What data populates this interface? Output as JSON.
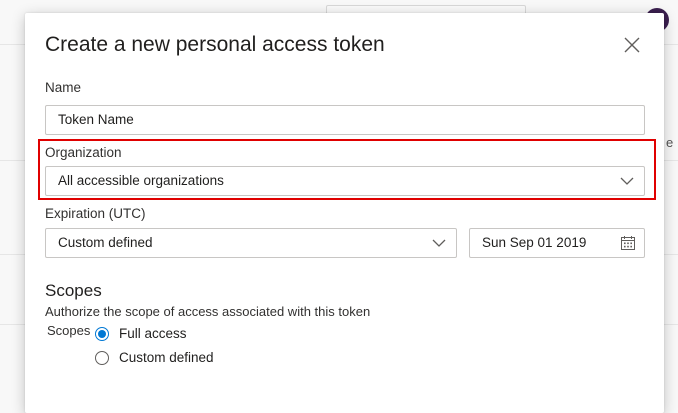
{
  "dialog": {
    "title": "Create a new personal access token",
    "close_icon": "close-icon"
  },
  "name": {
    "label": "Name",
    "value": "Token Name"
  },
  "organization": {
    "label": "Organization",
    "selected": "All accessible organizations"
  },
  "expiration": {
    "label": "Expiration (UTC)",
    "selected": "Custom defined",
    "date": "Sun Sep 01 2019"
  },
  "scopes": {
    "heading": "Scopes",
    "description": "Authorize the scope of access associated with this token",
    "label": "Scopes",
    "options": [
      {
        "label": "Full access",
        "checked": true
      },
      {
        "label": "Custom defined",
        "checked": false
      }
    ]
  },
  "colors": {
    "accent": "#0078d4",
    "highlight": "#e00000"
  }
}
